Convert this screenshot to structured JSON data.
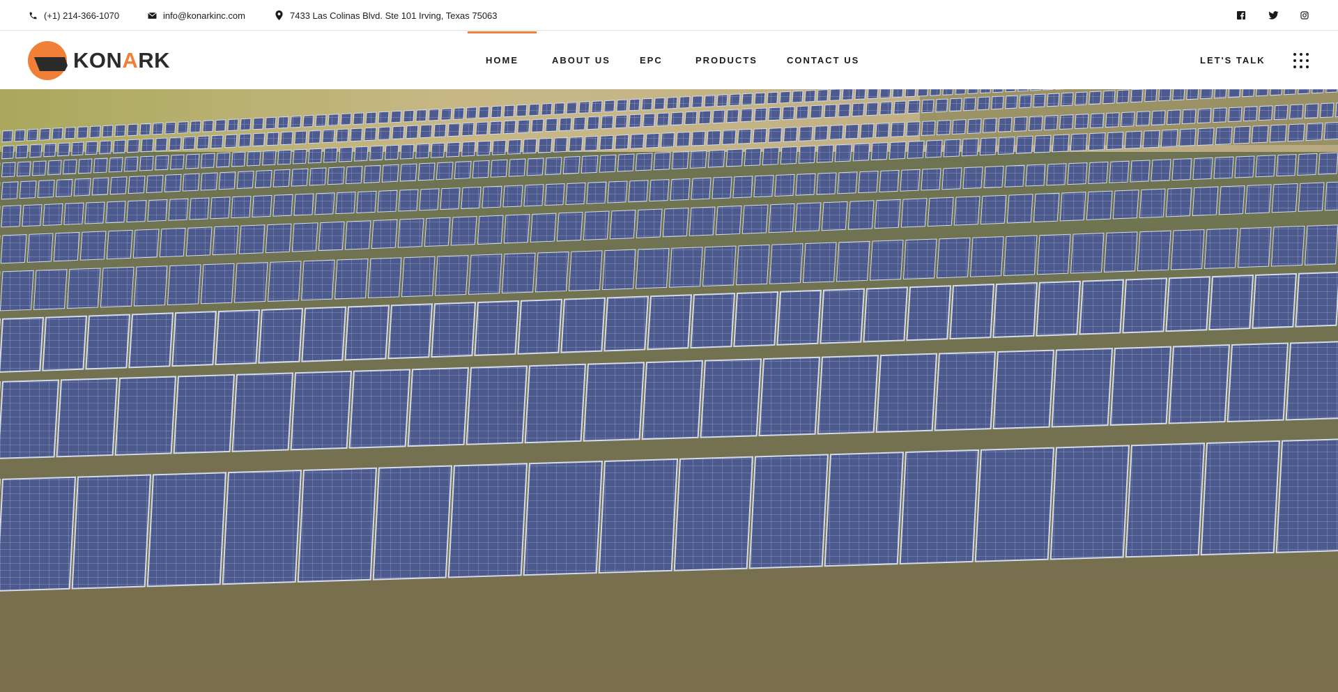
{
  "topbar": {
    "phone": "(+1) 214-366-1070",
    "email": "info@konarkinc.com",
    "address": "7433 Las Colinas Blvd. Ste 101 Irving, Texas 75063",
    "icons": {
      "phone": "phone-icon",
      "email": "envelope-icon",
      "address": "map-pin-icon"
    },
    "social": [
      "facebook-icon",
      "twitter-icon",
      "instagram-icon"
    ]
  },
  "header": {
    "logo_text_start": "KON",
    "logo_text_accent": "A",
    "logo_text_end": "RK",
    "nav": [
      {
        "label": "HOME",
        "active": true
      },
      {
        "label": "ABOUT US",
        "active": false
      },
      {
        "label": "EPC",
        "active": false
      },
      {
        "label": "PRODUCTS",
        "active": false
      },
      {
        "label": "CONTACT US",
        "active": false
      }
    ],
    "cta_label": "LET'S TALK",
    "menu_icon": "dots-grid-icon"
  },
  "colors": {
    "accent": "#f07f37",
    "text": "#1a1a1a",
    "panel": "#4b5d8f"
  },
  "hero": {
    "image_icon": "solar-farm-image"
  }
}
